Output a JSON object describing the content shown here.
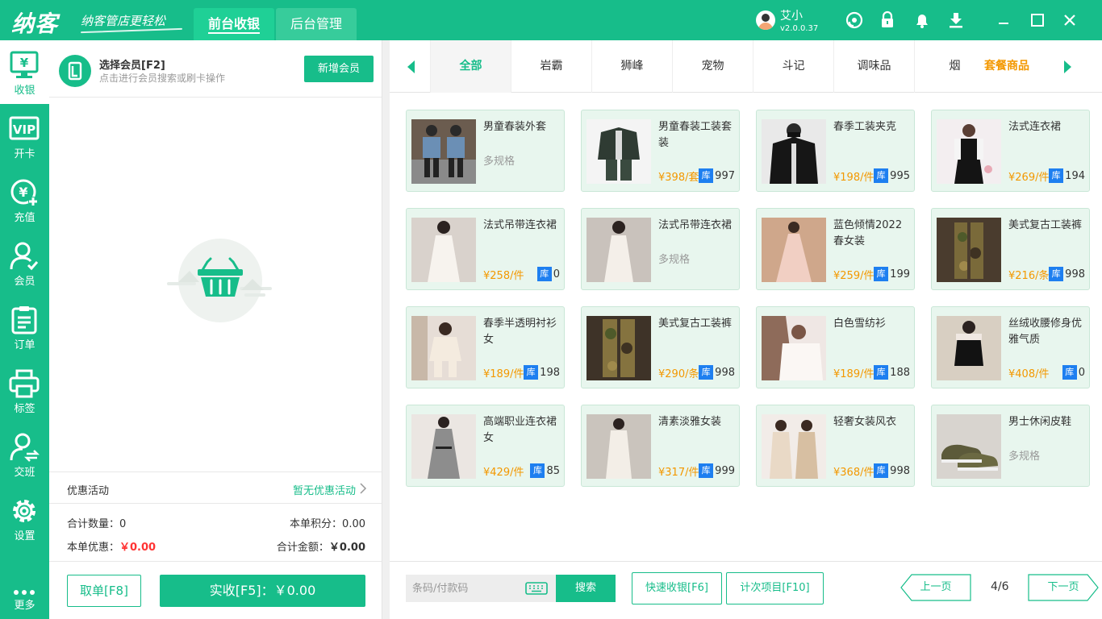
{
  "topbar": {
    "logo": "纳客",
    "slogan": "纳客管店更轻松",
    "tabs": [
      {
        "label": "前台收银"
      },
      {
        "label": "后台管理"
      }
    ],
    "user": {
      "name": "艾小",
      "version": "v2.0.0.37"
    },
    "icons": [
      "headset-icon",
      "lock-icon",
      "bell-icon",
      "download-icon",
      "minimize-icon",
      "maximize-icon",
      "close-icon"
    ]
  },
  "sidebar": {
    "items": [
      {
        "label": "收银",
        "icon": "cashier-icon"
      },
      {
        "label": "开卡",
        "icon": "vip-card-icon"
      },
      {
        "label": "充值",
        "icon": "recharge-icon"
      },
      {
        "label": "会员",
        "icon": "member-icon"
      },
      {
        "label": "订单",
        "icon": "order-icon"
      },
      {
        "label": "标签",
        "icon": "printer-icon"
      },
      {
        "label": "交班",
        "icon": "shift-icon"
      },
      {
        "label": "设置",
        "icon": "gear-icon"
      }
    ],
    "more": "更多"
  },
  "member": {
    "title": "选择会员[F2]",
    "subtitle": "点击进行会员搜索或刷卡操作",
    "new_button": "新增会员"
  },
  "promo": {
    "label": "优惠活动",
    "value": "暂无优惠活动"
  },
  "summary": {
    "qty_label": "合计数量：",
    "qty_value": "0",
    "points_label": "本单积分：",
    "points_value": "0.00",
    "discount_label": "本单优惠：",
    "discount_value": "￥0.00",
    "total_label": "合计金额：",
    "total_value": "￥0.00"
  },
  "actions": {
    "cancel": "取单[F8]",
    "pay": "实收[F5]：￥0.00"
  },
  "categories": [
    "全部",
    "岩霸",
    "狮峰",
    "宠物",
    "斗记",
    "调味品",
    "烟"
  ],
  "combo_category": "套餐商品",
  "products": [
    {
      "name": "男童春装外套",
      "spec": "多规格",
      "price": "",
      "stock": "",
      "img": "kids"
    },
    {
      "name": "男童春装工装套装",
      "spec": "",
      "price": "¥398/套",
      "stock": "997",
      "img": "workset"
    },
    {
      "name": "春季工装夹克",
      "spec": "",
      "price": "¥198/件",
      "stock": "995",
      "img": "jacket"
    },
    {
      "name": "法式连衣裙",
      "spec": "",
      "price": "¥269/件",
      "stock": "194",
      "img": "blackdress"
    },
    {
      "name": "法式吊带连衣裙",
      "spec": "",
      "price": "¥258/件",
      "stock": "0",
      "img": "whitedress"
    },
    {
      "name": "法式吊带连衣裙",
      "spec": "多规格",
      "price": "",
      "stock": "",
      "img": "whitedress2"
    },
    {
      "name": "蓝色倾情2022春女装",
      "spec": "",
      "price": "¥259/件",
      "stock": "199",
      "img": "pinkdress"
    },
    {
      "name": "美式复古工装裤",
      "spec": "",
      "price": "¥216/条",
      "stock": "998",
      "img": "camo"
    },
    {
      "name": "春季半透明衬衫女",
      "spec": "",
      "price": "¥189/件",
      "stock": "198",
      "img": "sheershirt"
    },
    {
      "name": "美式复古工装裤",
      "spec": "",
      "price": "¥290/条",
      "stock": "998",
      "img": "camo2"
    },
    {
      "name": "白色雪纺衫",
      "spec": "",
      "price": "¥189/件",
      "stock": "188",
      "img": "chiffon"
    },
    {
      "name": "丝绒收腰修身优雅气质",
      "spec": "",
      "price": "¥408/件",
      "stock": "0",
      "img": "velvet"
    },
    {
      "name": "高端职业连衣裙女",
      "spec": "",
      "price": "¥429/件",
      "stock": "85",
      "img": "greydress"
    },
    {
      "name": "清素淡雅女装",
      "spec": "",
      "price": "¥317/件",
      "stock": "999",
      "img": "lacedress"
    },
    {
      "name": "轻奢女装风衣",
      "spec": "",
      "price": "¥368/件",
      "stock": "998",
      "img": "trench"
    },
    {
      "name": "男士休闲皮鞋",
      "spec": "多规格",
      "price": "",
      "stock": "",
      "img": "shoes"
    }
  ],
  "stock_badge": "库",
  "bottom": {
    "search_placeholder": "条码/付款码",
    "search_button": "搜索",
    "quick_pay": "快速收银[F6]",
    "count_item": "计次项目[F10]",
    "prev": "上一页",
    "next": "下一页",
    "page": "4/6"
  },
  "colors": {
    "primary": "#17bd8a",
    "price": "#f39800",
    "stock_badge": "#1e7ff0",
    "card_bg": "#e8f6ee"
  }
}
